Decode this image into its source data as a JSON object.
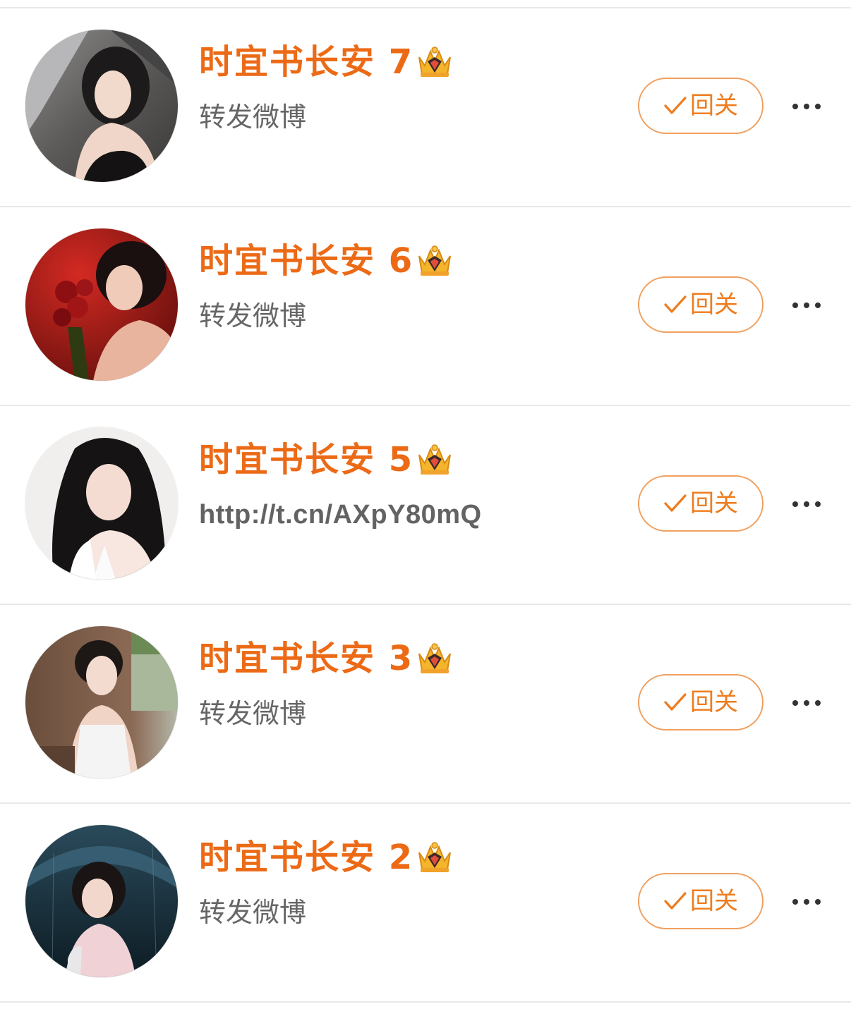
{
  "users": [
    {
      "name": "时宜书长安 7",
      "subtitle": "转发微博",
      "follow_label": "回关",
      "avatar": "portrait-gray-background"
    },
    {
      "name": "时宜书长安 6",
      "subtitle": "转发微博",
      "follow_label": "回关",
      "avatar": "portrait-red-roses"
    },
    {
      "name": "时宜书长安 5",
      "subtitle": "http://t.cn/AXpY80mQ",
      "follow_label": "回关",
      "avatar": "portrait-white-background"
    },
    {
      "name": "时宜书长安 3",
      "subtitle": "转发微博",
      "follow_label": "回关",
      "avatar": "portrait-in-car"
    },
    {
      "name": "时宜书长安 2",
      "subtitle": "转发微博",
      "follow_label": "回关",
      "avatar": "portrait-rain-umbrella"
    }
  ],
  "colors": {
    "name": "#ec6a16",
    "button_border": "#f0a060",
    "button_text": "#ee7c1e",
    "subtitle": "#666666",
    "divider": "#e8e8e8"
  },
  "icons": {
    "badge": "crown-icon",
    "follow": "checkmark-icon",
    "more": "more-dots-icon"
  }
}
